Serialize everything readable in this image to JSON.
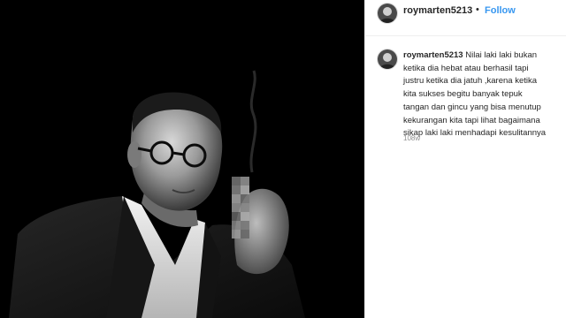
{
  "post": {
    "username": "roymarten5213",
    "separator": "•",
    "follow_label": "Follow",
    "caption_lines": [
      "Nilai laki laki bukan",
      "ketika dia hebat atau berhasil tapi",
      "justru ketika dia jatuh ,karena ketika",
      "kita sukses begitu banyak tepuk",
      "tangan dan gincu yang bisa menutup",
      "kekurangan kita tapi lihat bagaimana",
      "sikap laki laki menhadapi kesulitannya"
    ],
    "timestamp": "108w"
  },
  "photo": {
    "description_icon": "portrait-photo",
    "tone": "black-and-white",
    "background_color": "#000000"
  },
  "colors": {
    "link": "#3897f0",
    "text": "#262626",
    "muted": "#8e8e8e",
    "border": "#efefef"
  }
}
